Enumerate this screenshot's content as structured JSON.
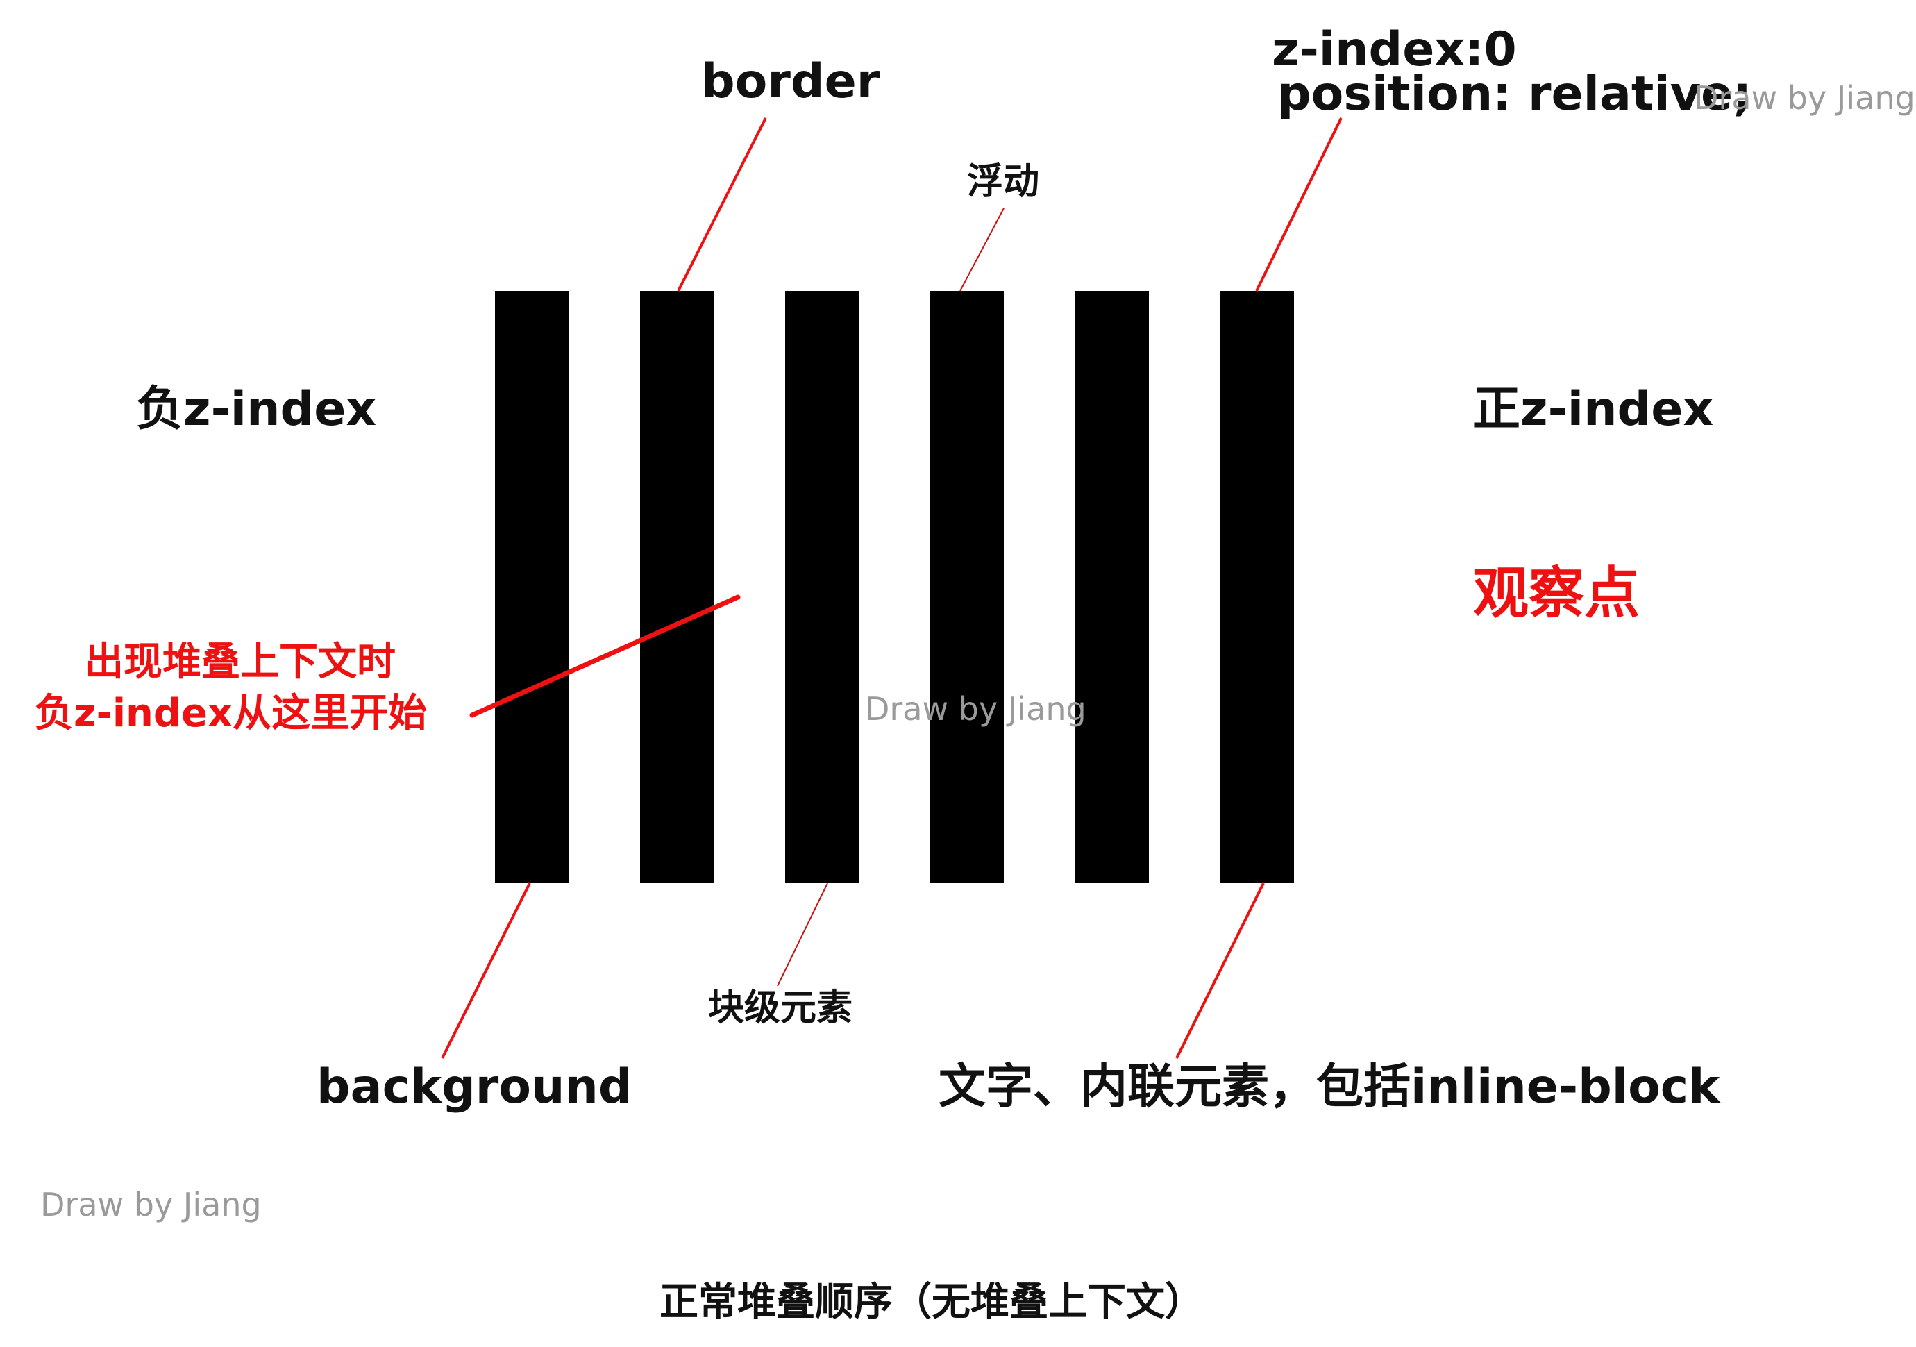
{
  "labels": {
    "border": "border",
    "float": "浮动",
    "zindex_zero_line1": "z-index:0",
    "zindex_zero_line2": "position: relative;",
    "negative_zindex": "负z-index",
    "positive_zindex": "正z-index",
    "observation_point": "观察点",
    "negative_start_line1": "出现堆叠上下文时",
    "negative_start_line2": "负z-index从这里开始",
    "block_element": "块级元素",
    "background": "background",
    "inline_text": "文字、内联元素，包括inline-block",
    "caption": "正常堆叠顺序（无堆叠上下文）"
  },
  "watermarks": {
    "top_right": "Draw by Jiang",
    "center": "Draw by Jiang",
    "bottom_left": "Draw by Jiang"
  },
  "layers": [
    "background",
    "border",
    "块级元素",
    "浮动",
    "文字、内联元素，包括inline-block",
    "z-index:0 position: relative;"
  ],
  "colors": {
    "bar": "#000000",
    "leader_line": "#ee1111",
    "leader_line_thin": "#cc1111",
    "accent_text": "#ee1111",
    "watermark": "#9a9a9a"
  }
}
